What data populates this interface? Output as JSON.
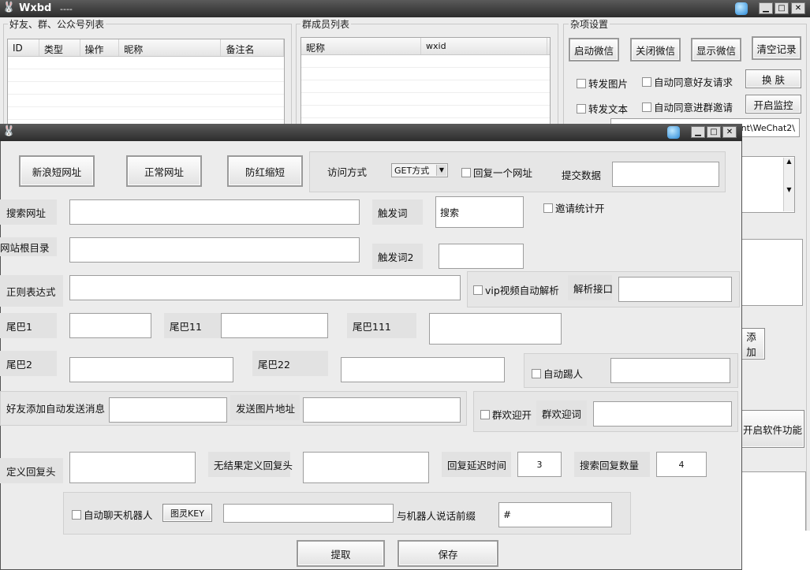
{
  "main_window": {
    "title": "Wxbd",
    "title_suffix": "----",
    "friends_group": {
      "title": "好友、群、公众号列表",
      "columns": [
        "ID",
        "类型",
        "操作",
        "昵称",
        "备注名"
      ]
    },
    "members_group": {
      "title": "群成员列表",
      "columns": [
        "昵称",
        "wxid"
      ]
    },
    "misc_group": {
      "title": "杂项设置",
      "buttons": [
        "启动微信",
        "关闭微信",
        "显示微信",
        "清空记录"
      ],
      "forward_image": "转发图片",
      "auto_friend": "自动同意好友请求",
      "skin_button": "换 肤",
      "forward_text": "转发文本",
      "auto_group": "自动同意进群邀请",
      "monitor_button": "开启监控",
      "path_value": "nt\\WeChat2\\"
    },
    "add_button_partial": "添 加",
    "enable_features_partial": "开启软件功能"
  },
  "dialog": {
    "buttons": {
      "sina_short": "新浪短网址",
      "normal_url": "正常网址",
      "anti_red": "防红缩短",
      "extract": "提取",
      "save": "保存"
    },
    "access_method_label": "访问方式",
    "access_method_value": "GET方式",
    "reply_one_url": "回复一个网址",
    "submit_data_label": "提交数据",
    "search_url_label": "搜索网址",
    "trigger_label": "触发词",
    "trigger_value": "搜索",
    "invite_stats": "邀请统计开",
    "site_root_label": "网站根目录",
    "trigger2_label": "触发词2",
    "regex_label": "正则表达式",
    "vip_parse": "vip视频自动解析",
    "parse_api_label": "解析接口",
    "tail1_label": "尾巴1",
    "tail11_label": "尾巴11",
    "tail111_label": "尾巴111",
    "tail2_label": "尾巴2",
    "tail22_label": "尾巴22",
    "auto_kick": "自动踢人",
    "friend_add_msg_label": "好友添加自动发送消息",
    "send_image_label": "发送图片地址",
    "welcome_on": "群欢迎开",
    "welcome_label": "群欢迎词",
    "custom_reply_head_label": "定义回复头",
    "no_result_head_label": "无结果定义回复头",
    "reply_delay_label": "回复延迟时间",
    "reply_delay_value": "3",
    "search_reply_count_label": "搜索回复数量",
    "search_reply_count_value": "4",
    "auto_chat_robot": "自动聊天机器人",
    "tuling_key_button": "图灵KEY",
    "robot_prefix_label": "与机器人说话前缀",
    "robot_prefix_value": "#"
  }
}
